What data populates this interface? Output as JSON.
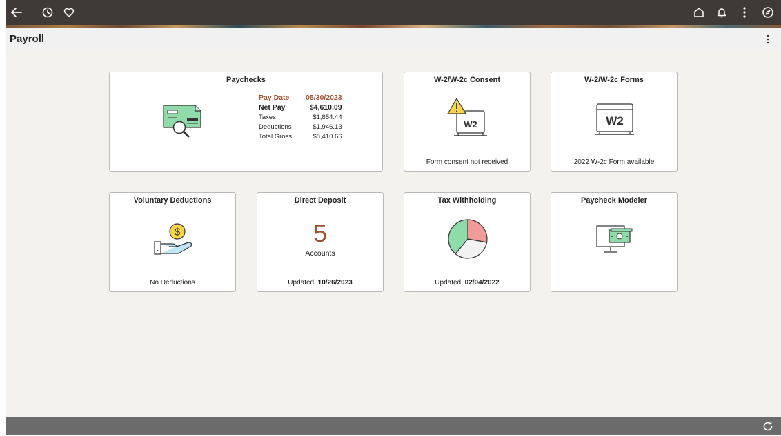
{
  "header": {
    "title": "Payroll"
  },
  "tiles": {
    "paychecks": {
      "title": "Paychecks",
      "pay_date_label": "Pay Date",
      "pay_date": "05/30/2023",
      "net_pay_label": "Net Pay",
      "net_pay": "$4,610.09",
      "taxes_label": "Taxes",
      "taxes": "$1,854.44",
      "deductions_label": "Deductions",
      "deductions": "$1,946.13",
      "total_gross_label": "Total Gross",
      "total_gross": "$8,410.66",
      "icon": "paycheck-search-icon"
    },
    "consent": {
      "title": "W-2/W-2c Consent",
      "icon_text": "W2",
      "footer": "Form consent not received",
      "icon": "w2-consent-warning-icon"
    },
    "forms": {
      "title": "W-2/W-2c Forms",
      "icon_text": "W2",
      "footer": "2022 W-2c Form available",
      "icon": "w2-form-icon"
    },
    "voluntary": {
      "title": "Voluntary Deductions",
      "footer": "No Deductions",
      "icon": "hand-coin-icon"
    },
    "direct_deposit": {
      "title": "Direct Deposit",
      "count": "5",
      "count_label": "Accounts",
      "updated_label": "Updated",
      "updated": "10/26/2023"
    },
    "tax_withholding": {
      "title": "Tax Withholding",
      "updated_label": "Updated",
      "updated": "02/04/2022",
      "icon": "pie-chart-icon"
    },
    "modeler": {
      "title": "Paycheck Modeler",
      "icon": "monitor-cash-icon"
    }
  },
  "topbar_icons": [
    "back-arrow-icon",
    "history-icon",
    "favorites-heart-icon",
    "home-icon",
    "notifications-bell-icon",
    "actions-menu-icon",
    "navigator-compass-icon"
  ],
  "colors": {
    "topbar": "#3f3a37",
    "accent": "#a0502a",
    "tile_green": "#8fdcaa",
    "tile_red": "#f29b9b"
  }
}
